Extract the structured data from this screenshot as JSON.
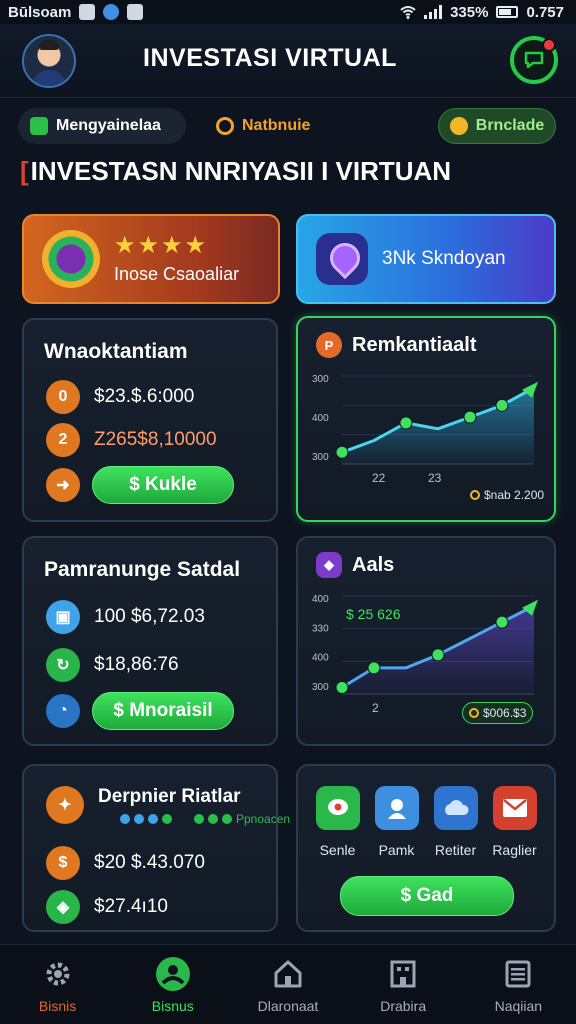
{
  "status_bar": {
    "carrier": "Būlsoam",
    "battery_percent": "335%",
    "time": "0.757"
  },
  "header": {
    "title": "INVESTASI VIRTUAL",
    "avatar_icon": "user-avatar-icon",
    "message_icon": "chat-bubble-icon",
    "notification_dot_color": "#f23a3a"
  },
  "chips": [
    {
      "label": "Mengyainelaa",
      "icon": "wallet-icon"
    },
    {
      "label": "Natbnuie",
      "icon": "clock-icon"
    },
    {
      "label": "Brnclade",
      "icon": "coin-icon"
    }
  ],
  "section_title": {
    "bracket": "[",
    "text": "INVESTASN NNRIYASII I VIRTUAN"
  },
  "features": {
    "left": {
      "stars": "★★★★",
      "label": "Inose Csaoaliar",
      "icon": "badge-icon"
    },
    "right": {
      "label": "3Nk Skndoyan",
      "icon": "location-pin-icon"
    }
  },
  "card_wallet": {
    "title": "Wnaoktantiam",
    "rows": [
      {
        "icon_text": "0",
        "value": "$23.$.6:000"
      },
      {
        "icon_text": "2",
        "value": "Z265$8,10000"
      },
      {
        "icon_text": "➜",
        "value": ""
      }
    ],
    "button": "$ Kukle"
  },
  "card_chart1": {
    "title": "Remkantiaalt",
    "icon_text": "P",
    "badge": "$nab 2.200"
  },
  "card_portfolio": {
    "title": "Pamranunge Satdal",
    "rows": [
      {
        "value": "100 $6,72.03"
      },
      {
        "value": "$18,86:76"
      }
    ],
    "button": "$ Mnoraisil"
  },
  "card_chart2": {
    "title": "Aals",
    "icon_text": "◆",
    "annotation": "$ 25 626",
    "badge": "$006.$3"
  },
  "card_rewards": {
    "title": "Derpnier Riatlar",
    "dots_label": "Ppnoacen",
    "rows": [
      {
        "value": "$20 $.43.070"
      },
      {
        "value": "$27.4ı10"
      }
    ]
  },
  "card_apps": {
    "apps": [
      {
        "label": "Senle",
        "icon": "chat-icon"
      },
      {
        "label": "Pamk",
        "icon": "person-icon"
      },
      {
        "label": "Retiter",
        "icon": "cloud-icon"
      },
      {
        "label": "Raglier",
        "icon": "envelope-icon"
      }
    ],
    "button": "$ Gad"
  },
  "bottom_nav": [
    {
      "label": "Bisnis",
      "icon": "gear-icon",
      "active": false
    },
    {
      "label": "Bisnus",
      "icon": "profile-icon",
      "active": true
    },
    {
      "label": "Dlaronaat",
      "icon": "home-icon",
      "active": false
    },
    {
      "label": "Drabira",
      "icon": "building-icon",
      "active": false
    },
    {
      "label": "Naqiian",
      "icon": "menu-icon",
      "active": false
    }
  ],
  "chart_data": [
    {
      "type": "line",
      "title": "Remkantiaalt",
      "x": [
        0,
        1,
        2,
        3,
        4,
        5,
        6
      ],
      "series": [
        {
          "values": [
            300,
            340,
            400,
            380,
            420,
            460,
            520
          ]
        }
      ],
      "y_ticks": [
        "300",
        "400",
        "300"
      ],
      "x_ticks": [
        "22",
        "23"
      ],
      "ylim": [
        260,
        560
      ]
    },
    {
      "type": "line",
      "title": "Aals",
      "x": [
        0,
        1,
        2,
        3,
        4,
        5,
        6
      ],
      "series": [
        {
          "values": [
            300,
            360,
            360,
            400,
            450,
            500,
            550
          ]
        }
      ],
      "y_ticks": [
        "400",
        "330",
        "400",
        "300"
      ],
      "x_ticks": [
        "2"
      ],
      "ylim": [
        280,
        580
      ]
    }
  ]
}
